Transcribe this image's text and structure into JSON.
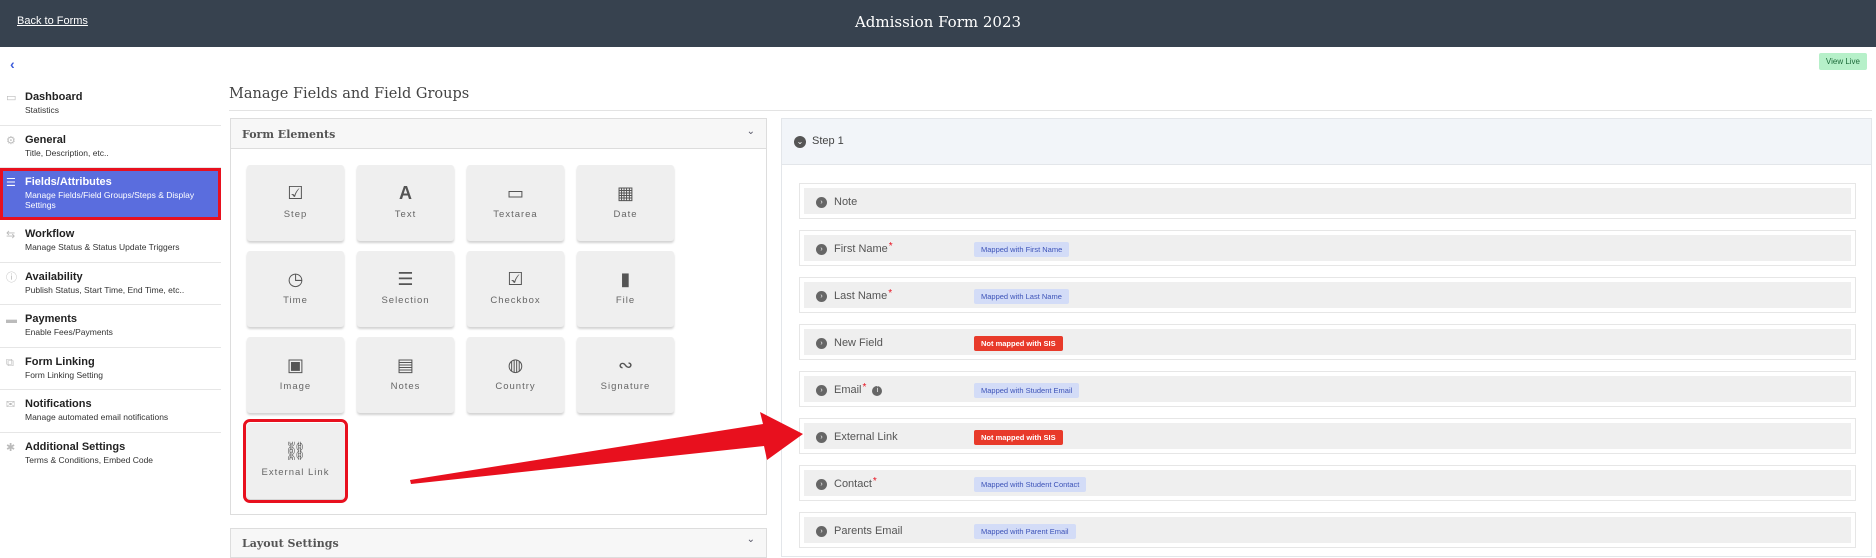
{
  "header": {
    "back_link": "Back to Forms",
    "title": "Admission Form 2023"
  },
  "toolbar": {
    "collapse_icon": "chevron-left-icon",
    "view_live": "View Live"
  },
  "sidebar": {
    "items": [
      {
        "title": "Dashboard",
        "desc": "Statistics",
        "icon": "monitor-icon"
      },
      {
        "title": "General",
        "desc": "Title, Description, etc..",
        "icon": "gear-icon"
      },
      {
        "title": "Fields/Attributes",
        "desc": "Manage Fields/Field Groups/Steps & Display Settings",
        "icon": "menu-icon"
      },
      {
        "title": "Workflow",
        "desc": "Manage Status & Status Update Triggers",
        "icon": "workflow-icon"
      },
      {
        "title": "Availability",
        "desc": "Publish Status, Start Time, End Time, etc..",
        "icon": "info-icon"
      },
      {
        "title": "Payments",
        "desc": "Enable Fees/Payments",
        "icon": "credit-card-icon"
      },
      {
        "title": "Form Linking",
        "desc": "Form Linking Setting",
        "icon": "link-icon"
      },
      {
        "title": "Notifications",
        "desc": "Manage automated email notifications",
        "icon": "envelope-icon"
      },
      {
        "title": "Additional Settings",
        "desc": "Terms & Conditions, Embed Code",
        "icon": "asterisk-icon"
      }
    ]
  },
  "main": {
    "title": "Manage Fields and Field Groups",
    "form_elements": {
      "title": "Form Elements",
      "tiles": [
        "Step",
        "Text",
        "Textarea",
        "Date",
        "Time",
        "Selection",
        "Checkbox",
        "File",
        "Image",
        "Notes",
        "Country",
        "Signature",
        "External Link"
      ]
    },
    "layout_settings": {
      "title": "Layout Settings"
    }
  },
  "steps": {
    "title": "Step 1",
    "fields": [
      {
        "label": "Note",
        "required": false,
        "info": false,
        "badge": ""
      },
      {
        "label": "First Name",
        "required": true,
        "info": false,
        "badge": "Mapped with First Name",
        "mapped": true
      },
      {
        "label": "Last Name",
        "required": true,
        "info": false,
        "badge": "Mapped with Last Name",
        "mapped": true
      },
      {
        "label": "New Field",
        "required": false,
        "info": false,
        "badge": "Not mapped with SIS",
        "mapped": false
      },
      {
        "label": "Email",
        "required": true,
        "info": true,
        "badge": "Mapped with Student Email",
        "mapped": true
      },
      {
        "label": "External Link",
        "required": false,
        "info": false,
        "badge": "Not mapped with SIS",
        "mapped": false
      },
      {
        "label": "Contact",
        "required": true,
        "info": false,
        "badge": "Mapped with Student Contact",
        "mapped": true
      },
      {
        "label": "Parents Email",
        "required": false,
        "info": false,
        "badge": "Mapped with Parent Email",
        "mapped": true
      }
    ]
  },
  "colors": {
    "header_bg": "#37424f",
    "active_bg": "#5a6dde",
    "highlight": "#e8101e",
    "mapped_bg": "#d3dcf7",
    "unmapped_bg": "#e83a2a",
    "view_live_bg": "#b6f0c9"
  }
}
